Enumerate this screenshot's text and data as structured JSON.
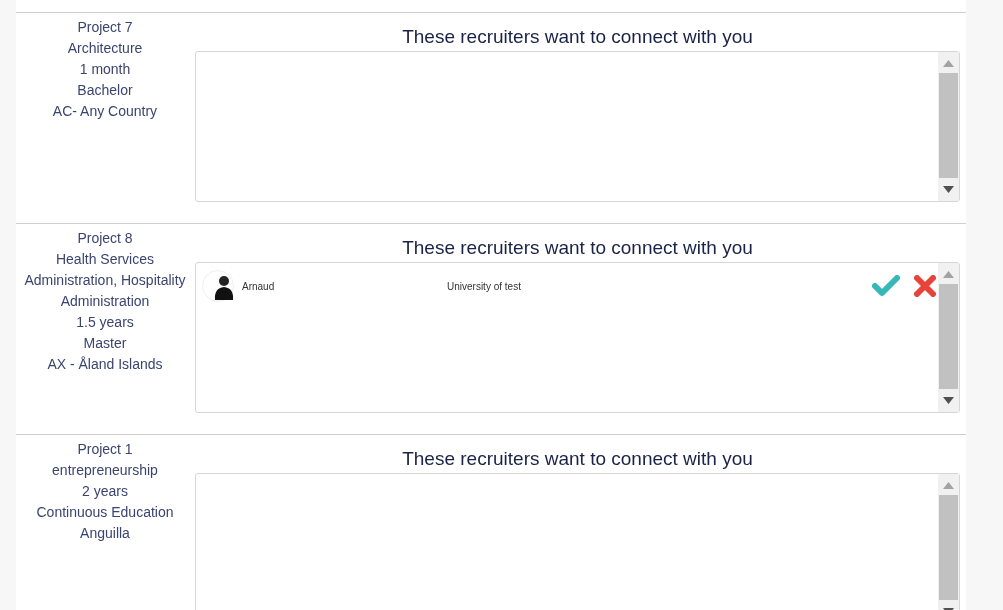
{
  "projects": [
    {
      "details": [
        "Project 7",
        "Architecture",
        "1 month",
        "Bachelor",
        "AC- Any Country"
      ],
      "heading": "These recruiters want to connect with you"
    },
    {
      "details": [
        "Project 8",
        "Health Services",
        "Administration, Hospitality",
        "Administration",
        "1.5 years",
        "Master",
        "AX - Åland Islands"
      ],
      "heading": "These recruiters want to connect with you",
      "recruiters": [
        {
          "name": "Arnaud",
          "organization": "University of test"
        }
      ]
    },
    {
      "details": [
        "Project 1",
        "entrepreneurship",
        "2 years",
        "Continuous Education",
        "Anguilla"
      ],
      "heading": "These recruiters want to connect with you"
    }
  ]
}
